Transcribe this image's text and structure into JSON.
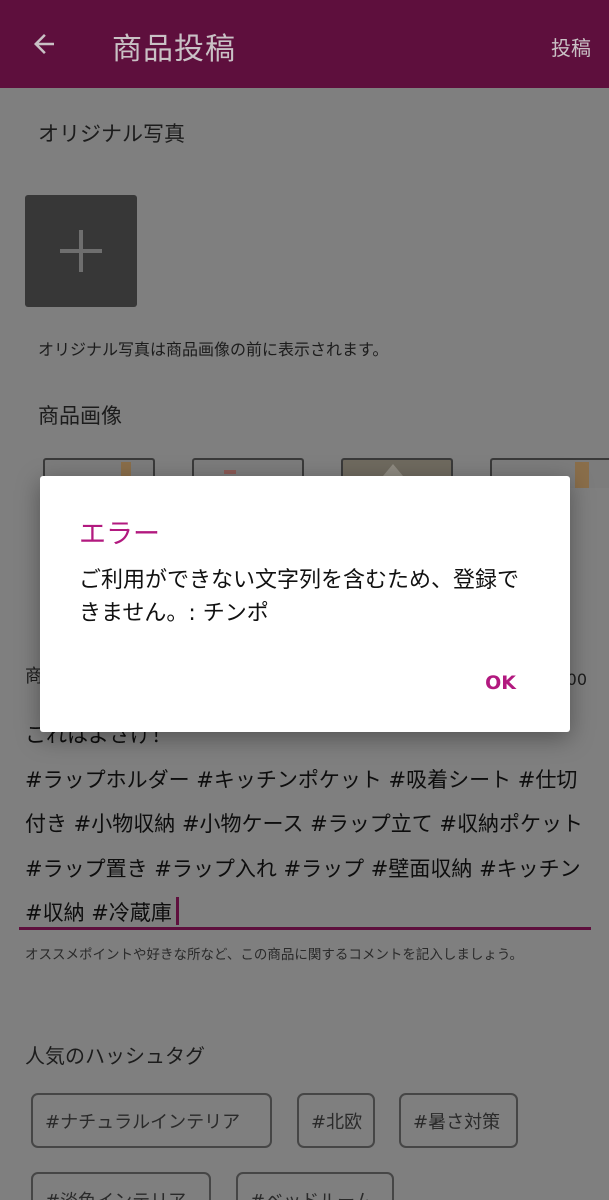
{
  "appbar": {
    "title": "商品投稿",
    "post_label": "投稿",
    "color": "#5e0f3d"
  },
  "original_photo": {
    "title": "オリジナル写真",
    "note": "オリジナル写真は商品画像の前に表示されます。"
  },
  "product_images": {
    "title": "商品画像",
    "thumbnail_count": 4
  },
  "comment": {
    "label": "商",
    "counter": "00",
    "text_first_line": "これはよさげ！",
    "text": "#ラップホルダー #キッチンポケット #吸着シート #仕切付き #小物収納 #小物ケース #ラップ立て #収納ポケット #ラップ置き #ラップ入れ #ラップ #壁面収納 #キッチン #収納 #冷蔵庫",
    "hint": "オススメポイントや好きな所など、この商品に関するコメントを記入しましょう。"
  },
  "popular_tags": {
    "title": "人気のハッシュタグ",
    "tags": [
      "#ナチュラルインテリア",
      "#北欧",
      "#暑さ対策",
      "#淡色インテリア",
      "#ベッドルーム"
    ]
  },
  "dialog": {
    "title": "エラー",
    "message": "ご利用ができない文字列を含むため、登録できません。: チンポ",
    "ok_label": "OK",
    "accent_color": "#b2197f"
  }
}
